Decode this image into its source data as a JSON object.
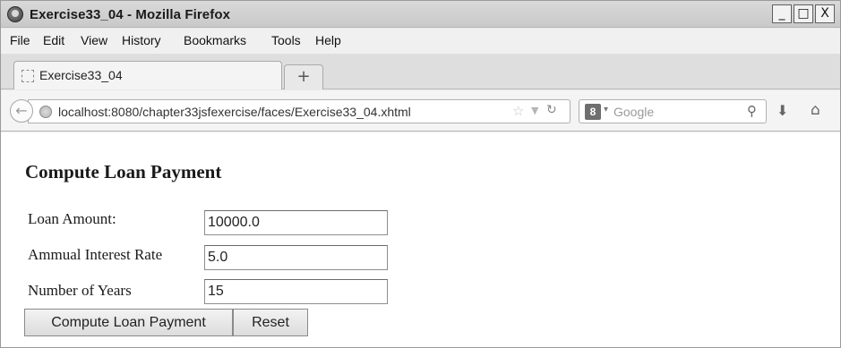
{
  "window": {
    "title": "Exercise33_04 - Mozilla Firefox",
    "controls": {
      "minimize": "_",
      "maximize": "□",
      "close": "X"
    }
  },
  "menu": {
    "items": [
      "File",
      "Edit",
      "View",
      "History",
      "Bookmarks",
      "Tools",
      "Help"
    ]
  },
  "tabs": {
    "active_label": "Exercise33_04",
    "new_tab_symbol": "+"
  },
  "nav": {
    "back_symbol": "←",
    "url": "localhost:8080/chapter33jsfexercise/faces/Exercise33_04.xhtml",
    "search_engine_badge": "8",
    "search_placeholder": "Google",
    "icons": [
      "back-icon",
      "globe-icon",
      "star-icon",
      "reload-icon",
      "search-icon",
      "download-icon",
      "home-icon"
    ]
  },
  "page": {
    "heading": "Compute Loan Payment",
    "fields": [
      {
        "label": "Loan Amount:",
        "value": "10000.0"
      },
      {
        "label": "Ammual Interest Rate",
        "value": "5.0"
      },
      {
        "label": "Number of Years",
        "value": "15"
      }
    ],
    "buttons": {
      "compute": "Compute Loan Payment",
      "reset": "Reset"
    }
  }
}
